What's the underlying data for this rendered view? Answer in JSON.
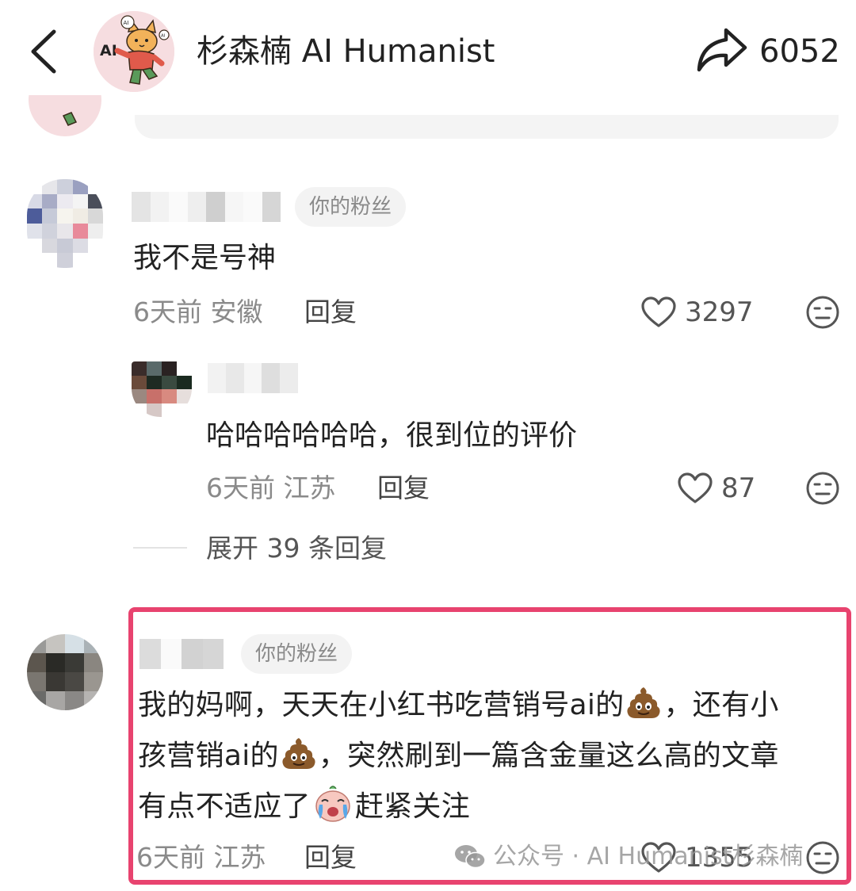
{
  "header": {
    "title": "杉森楠 AI Humanist",
    "share_count": "6052",
    "avatar_text": "AI"
  },
  "comments": [
    {
      "fan_badge": "你的粉丝",
      "text": "我不是号神",
      "time": "6天前",
      "location": "安徽",
      "reply_label": "回复",
      "likes": "3297",
      "replies": [
        {
          "text": "哈哈哈哈哈哈，很到位的评价",
          "time": "6天前",
          "location": "江苏",
          "reply_label": "回复",
          "likes": "87"
        }
      ],
      "expand_label": "展开 39 条回复"
    },
    {
      "fan_badge": "你的粉丝",
      "text_parts": [
        "我的妈啊，天天在小红书吃营销号ai的",
        "，还有小",
        "孩营销ai的",
        "，突然刷到一篇含金量这么高的文章",
        "有点不适应了",
        "赶紧关注"
      ],
      "time": "6天前",
      "location": "江苏",
      "reply_label": "回复",
      "likes": "1355"
    }
  ],
  "watermark": "公众号 · AI Humanist杉森楠",
  "colors": {
    "highlight": "#e8436f",
    "muted_text": "#8a8a8a",
    "badge_bg": "#f3f3f3"
  },
  "icons": [
    "back-arrow-icon",
    "share-arrow-icon",
    "heart-icon",
    "dislike-face-icon",
    "poop-emoji-icon",
    "crying-emoji-icon",
    "wechat-icon"
  ]
}
